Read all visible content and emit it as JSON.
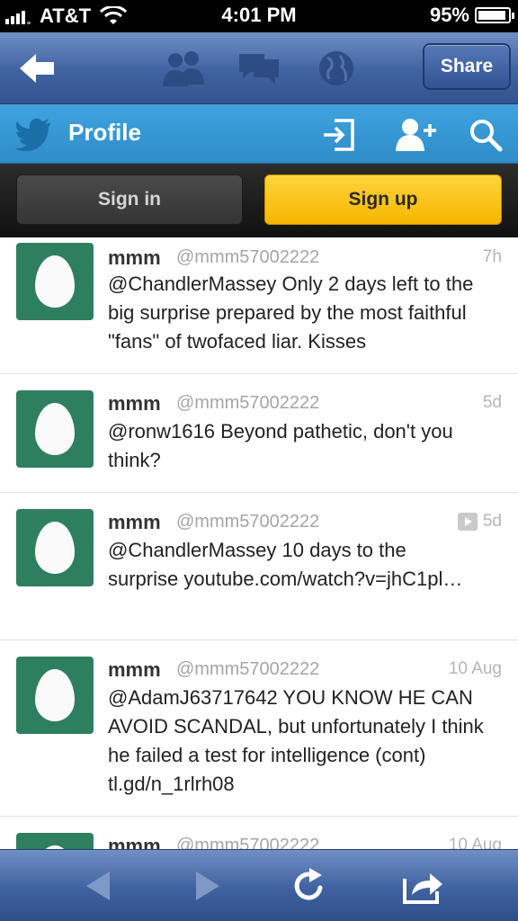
{
  "status_bar": {
    "carrier": "AT&T",
    "time": "4:01 PM",
    "battery": "95%",
    "battery_level": 0.95
  },
  "nav_bar": {
    "share_label": "Share"
  },
  "profile_bar": {
    "title": "Profile"
  },
  "auth": {
    "signin_label": "Sign in",
    "signup_label": "Sign up"
  },
  "tweets": [
    {
      "name": "mmm",
      "handle": "@mmm57002222",
      "time": "7h",
      "text": "@ChandlerMassey Only 2 days left to the big surprise prepared by the most faithful \"fans\" of twofaced liar. Kisses"
    },
    {
      "name": "mmm",
      "handle": "@mmm57002222",
      "time": "5d",
      "text": "@ronw1616 Beyond pathetic, don't you think?"
    },
    {
      "name": "mmm",
      "handle": "@mmm57002222",
      "time": "5d",
      "text": "@ChandlerMassey 10 days to the surprise youtube.com/watch?v=jhC1pl…"
    },
    {
      "name": "mmm",
      "handle": "@mmm57002222",
      "time": "10 Aug",
      "text": "@AdamJ63717642 YOU KNOW HE CAN AVOID SCANDAL, but unfortunately I think he failed a test for intelligence (cont) tl.gd/n_1rlrh08"
    },
    {
      "name": "mmm",
      "handle": "@mmm57002222",
      "time": "10 Aug",
      "text": ""
    }
  ]
}
